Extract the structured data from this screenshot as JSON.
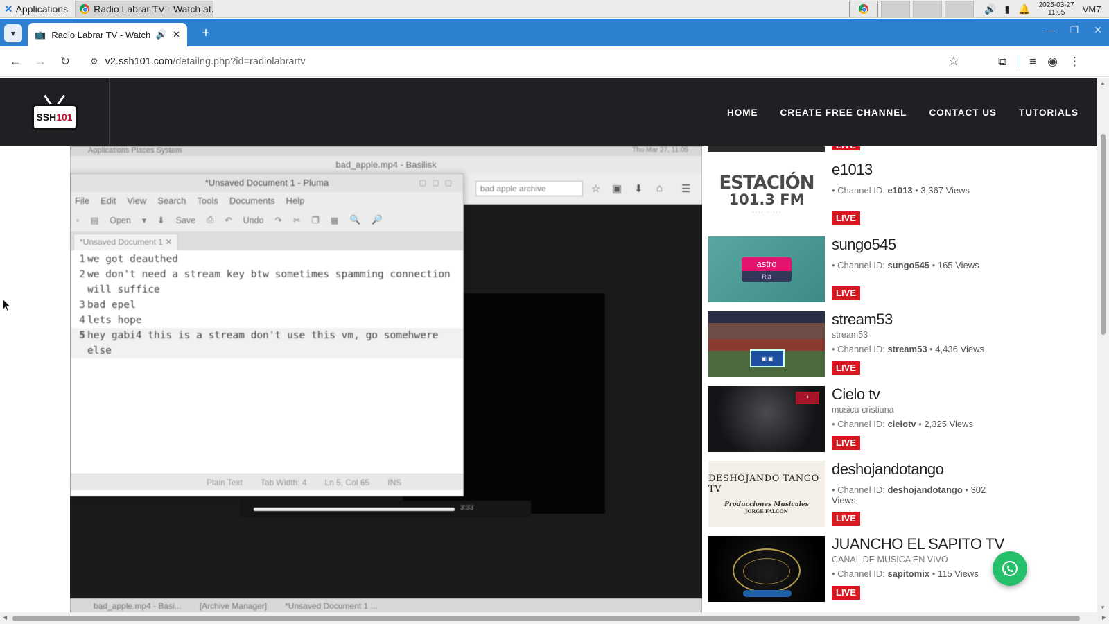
{
  "os": {
    "applications_label": "Applications",
    "taskbar_item": "Radio Labrar TV - Watch at...",
    "clock_date": "2025-03-27",
    "clock_time": "11:05",
    "user": "VM7"
  },
  "browser": {
    "tab_title": "Radio Labrar TV - Watch",
    "url_host": "v2.ssh101.com",
    "url_path": "/detailng.php?id=radiolabrartv"
  },
  "site": {
    "logo_text_prefix": "SSH",
    "logo_text_suffix": "101",
    "nav": [
      "HOME",
      "CREATE FREE CHANNEL",
      "CONTACT US",
      "TUTORIALS"
    ]
  },
  "video": {
    "vm_topbar": "Applications  Places  System",
    "vm_clock": "Thu Mar 27, 11:05",
    "basilisk_title": "bad_apple.mp4 - Basilisk",
    "basilisk_search": "bad apple archive",
    "player_time": "3:33",
    "pluma": {
      "title": "*Unsaved Document 1 - Pluma",
      "menu": [
        "File",
        "Edit",
        "View",
        "Search",
        "Tools",
        "Documents",
        "Help"
      ],
      "toolbar": [
        "Open",
        "Save",
        "Undo"
      ],
      "tab": "*Unsaved Document 1",
      "lines": [
        {
          "n": "1",
          "text": "we got deauthed"
        },
        {
          "n": "2",
          "text": "we don't need a stream key btw sometimes spamming connection will suffice"
        },
        {
          "n": "3",
          "text": "bad epel"
        },
        {
          "n": "4",
          "text": "lets hope"
        },
        {
          "n": "5",
          "text": "hey gabi4 this is a stream don't use this vm, go somehwere else"
        }
      ],
      "status": [
        "Plain Text",
        "Tab Width: 4",
        "Ln 5, Col 65",
        "INS"
      ]
    },
    "vm_taskbar": [
      "bad_apple.mp4 - Basi...",
      "[Archive Manager]",
      "*Unsaved Document 1 ..."
    ]
  },
  "channels": {
    "live_label": "LIVE",
    "channel_id_label": "Channel ID:",
    "views_label": "Views",
    "items": [
      {
        "name": "e1013",
        "desc": "",
        "id": "e1013",
        "views": "3,367",
        "thumb": "thumb-estacion"
      },
      {
        "name": "sungo545",
        "desc": "",
        "id": "sungo545",
        "views": "165",
        "thumb": "thumb-astro"
      },
      {
        "name": "stream53",
        "desc": "stream53",
        "id": "stream53",
        "views": "4,436",
        "thumb": "thumb-stadium"
      },
      {
        "name": "Cielo tv",
        "desc": "musica cristiana",
        "id": "cielotv",
        "views": "2,325",
        "thumb": "thumb-cielo"
      },
      {
        "name": "deshojandotango",
        "desc": "",
        "id": "deshojandotango",
        "views": "302",
        "thumb": "thumb-tango"
      },
      {
        "name": "JUANCHO EL SAPITO TV",
        "desc": "CANAL DE MUSICA EN VIVO",
        "id": "sapitomix",
        "views": "115",
        "thumb": "thumb-juancho"
      }
    ]
  },
  "thumb_text": {
    "estacion_1": "ESTACIÓN",
    "estacion_2": "101.3 FM",
    "astro_1": "astro",
    "astro_2": "Ria",
    "tango_1": "DESHOJANDO TANGO TV",
    "tango_2": "Producciones Musicales",
    "tango_3": "JORGE FALCON"
  },
  "colors": {
    "tabbar": "#2d7fd0",
    "site_header": "#1f2023",
    "live_badge": "#d71921",
    "whatsapp": "#26c06b"
  }
}
